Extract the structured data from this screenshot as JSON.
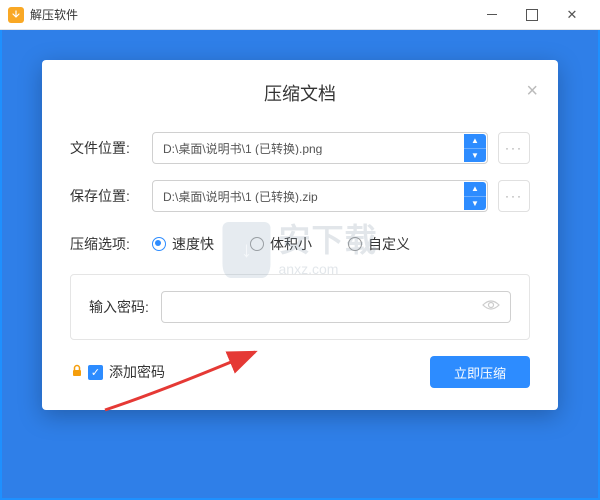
{
  "titlebar": {
    "app_title": "解压软件"
  },
  "modal": {
    "title": "压缩文档",
    "file_location_label": "文件位置:",
    "file_location_value": "D:\\桌面\\说明书\\1 (已转换).png",
    "save_location_label": "保存位置:",
    "save_location_value": "D:\\桌面\\说明书\\1 (已转换).zip",
    "options_label": "压缩选项:",
    "options": {
      "fast": "速度快",
      "small": "体积小",
      "custom": "自定义"
    },
    "password_label": "输入密码:",
    "add_password_label": "添加密码",
    "compress_button": "立即压缩",
    "more_button": "···"
  },
  "watermark": {
    "text": "安下载",
    "domain": "anxz.com"
  }
}
